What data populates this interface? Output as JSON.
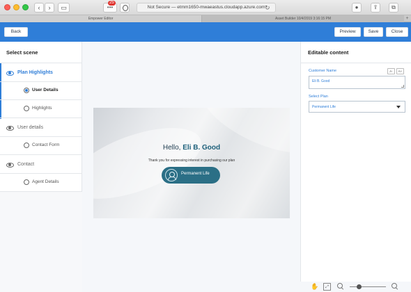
{
  "browser": {
    "url_text": "Not Secure — etmm1650-mwaeastus.cloudapp.azure.com",
    "extension_badge": "25",
    "tabs": [
      {
        "label": "Empower Editor"
      },
      {
        "label": "Asset Builder 10/4/2019 3:16:15 PM"
      }
    ]
  },
  "toolbar": {
    "back_label": "Back",
    "preview_label": "Preview",
    "save_label": "Save",
    "close_label": "Close"
  },
  "scenes": {
    "title": "Select scene",
    "sections": [
      {
        "label": "Plan Highlights",
        "active": true,
        "items": [
          {
            "label": "User Details",
            "selected": true
          },
          {
            "label": "Highlights",
            "selected": false
          }
        ]
      },
      {
        "label": "User details",
        "active": false,
        "items": [
          {
            "label": "Contact Form",
            "selected": false
          }
        ]
      },
      {
        "label": "Contact",
        "active": false,
        "items": [
          {
            "label": "Agent Details",
            "selected": false
          }
        ]
      }
    ]
  },
  "slide": {
    "greeting": "Hello,",
    "customer_name": "Eli B. Good",
    "message": "Thank you for expressing interest in purchasing our plan",
    "plan_button": "Permanent Life"
  },
  "editable": {
    "title": "Editable content",
    "customer_name_label": "Customer Name",
    "font_smaller": "A-",
    "font_larger": "A+",
    "customer_name_value": "Eli B. Good",
    "select_plan_label": "Select Plan",
    "select_plan_value": "Permanent Life"
  },
  "zoom": {
    "level": 0.25
  },
  "colors": {
    "accent": "#2f7ed8",
    "pill": "#2b6f86"
  }
}
